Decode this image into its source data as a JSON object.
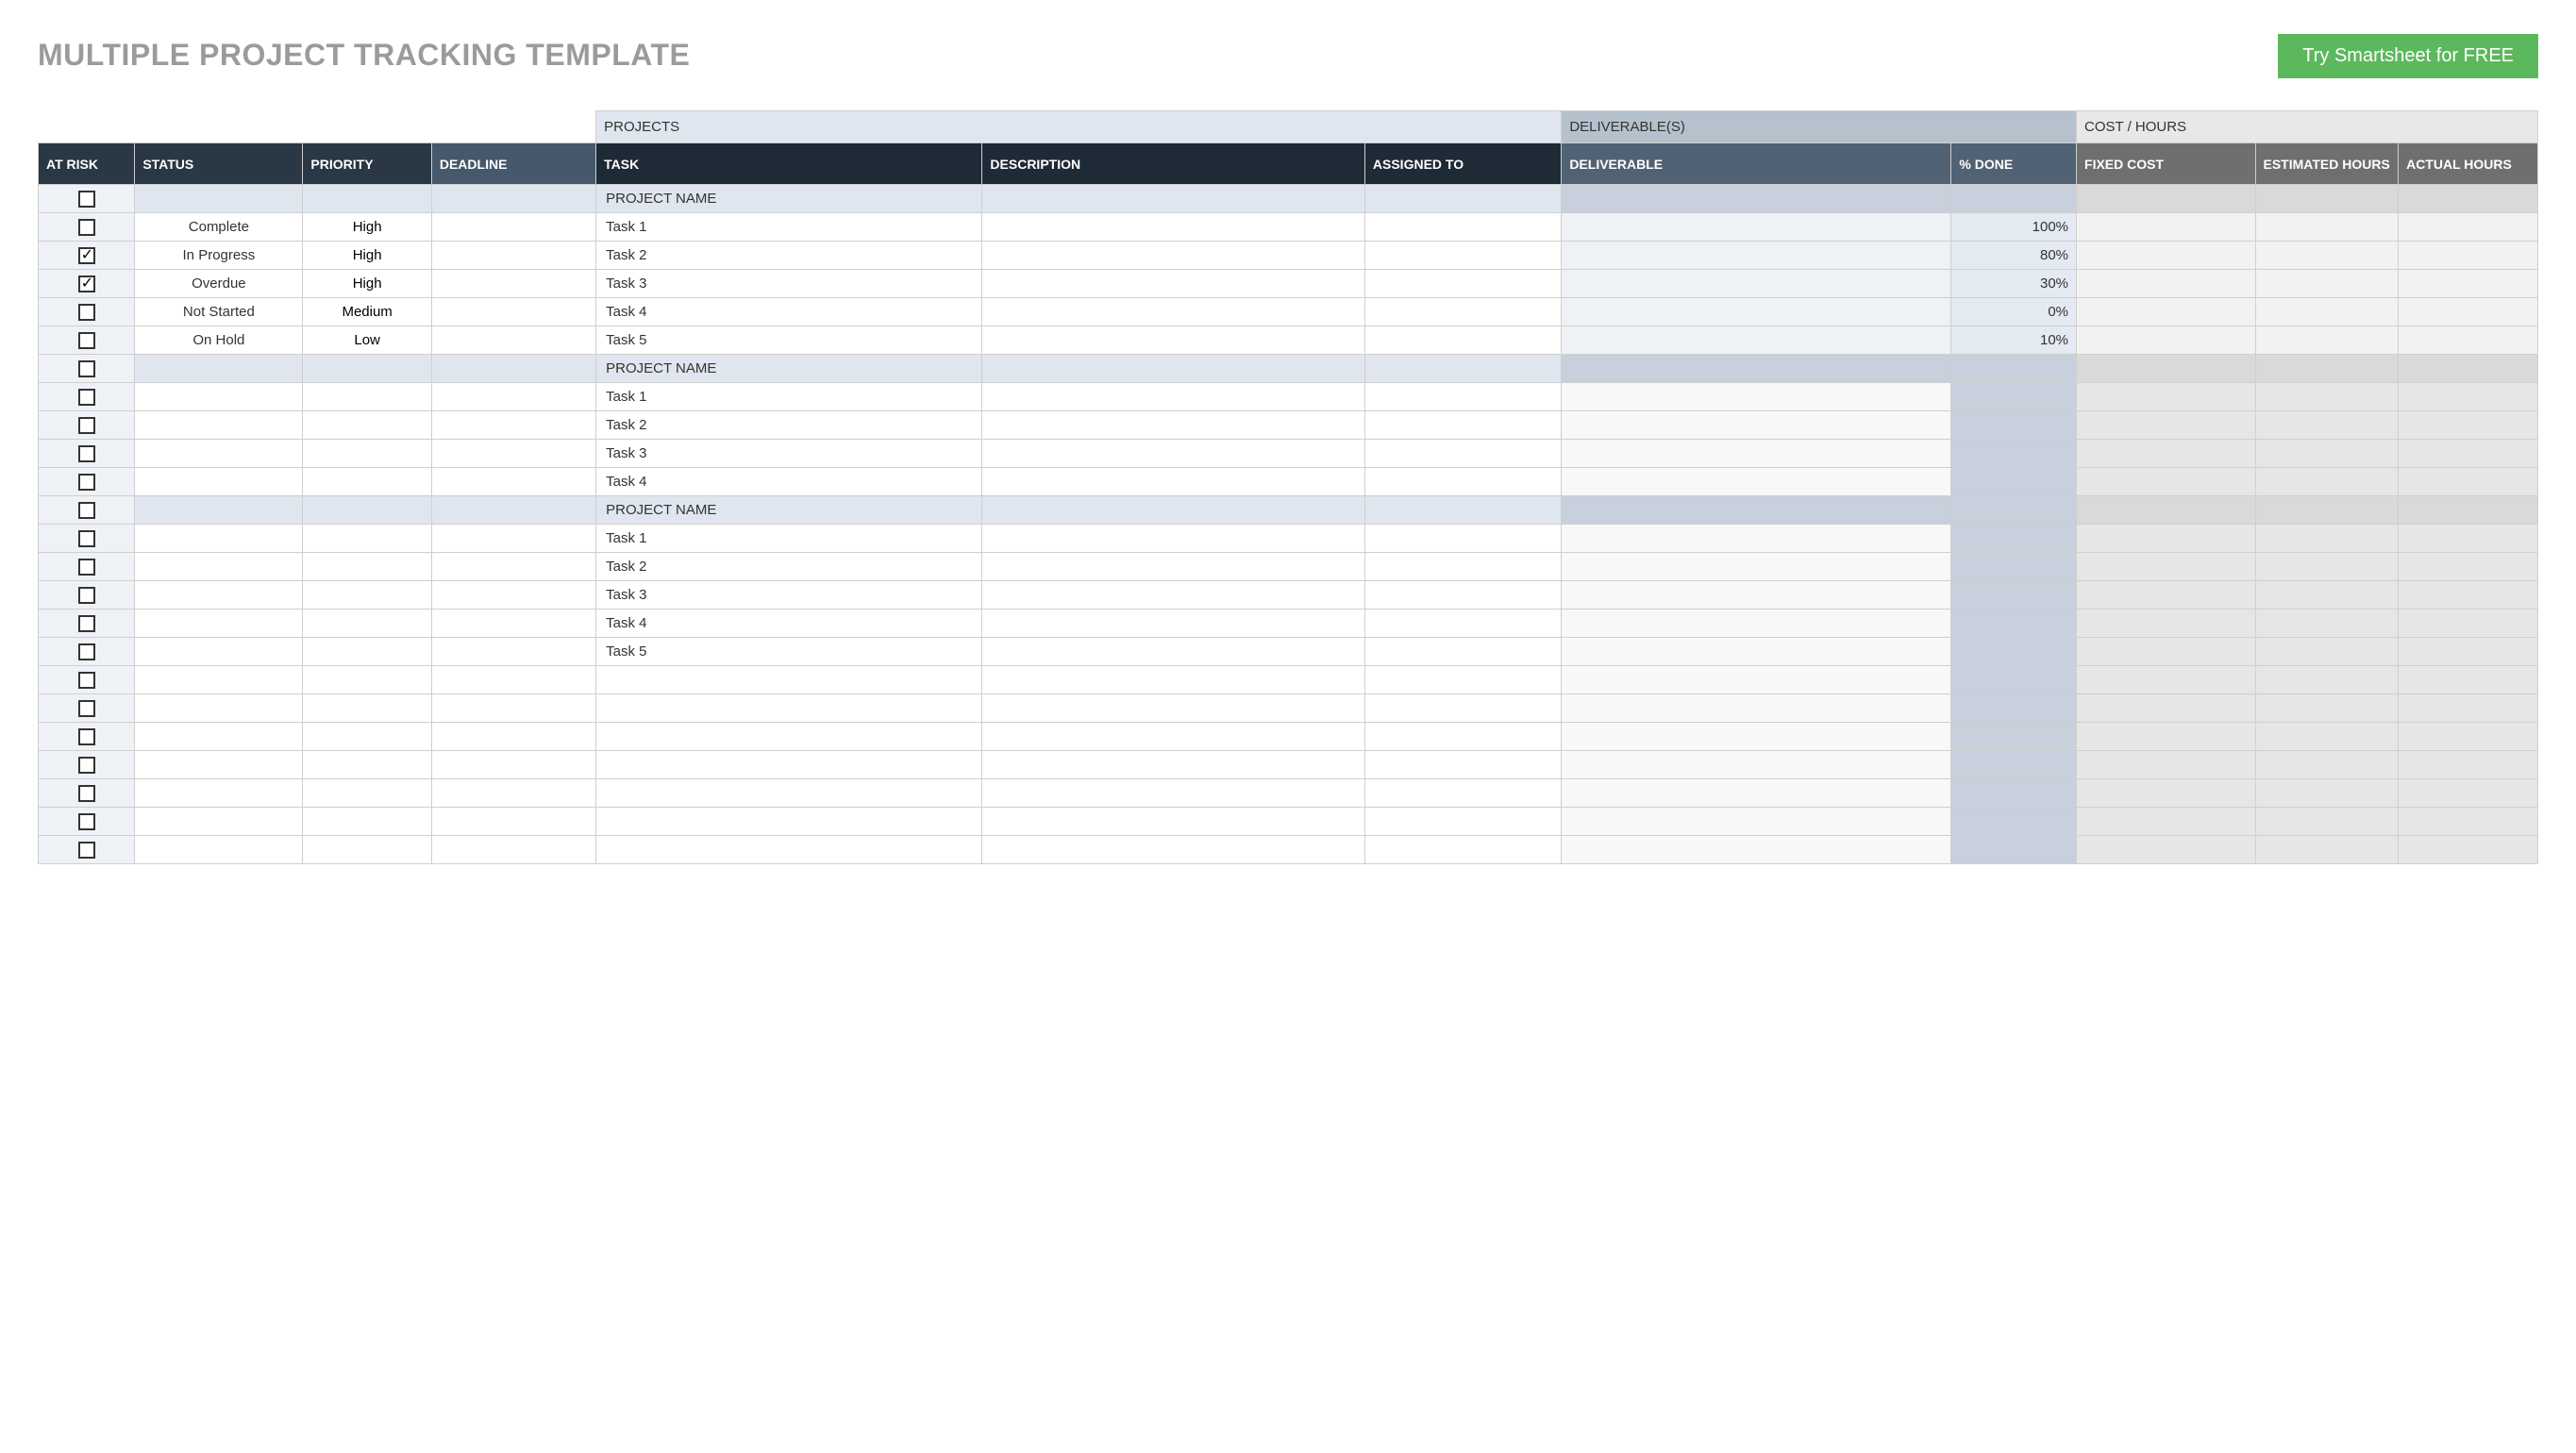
{
  "title": "MULTIPLE PROJECT TRACKING TEMPLATE",
  "cta": "Try Smartsheet for FREE",
  "categories": {
    "projects": "PROJECTS",
    "deliverables": "DELIVERABLE(S)",
    "cost": "COST / HOURS"
  },
  "headers": {
    "risk": "AT RISK",
    "status": "STATUS",
    "priority": "PRIORITY",
    "deadline": "DEADLINE",
    "task": "TASK",
    "description": "DESCRIPTION",
    "assigned": "ASSIGNED TO",
    "deliverable": "DELIVERABLE",
    "done": "% DONE",
    "fcost": "FIXED COST",
    "ehours": "ESTIMATED HOURS",
    "ahours": "ACTUAL HOURS"
  },
  "rows": [
    {
      "type": "project",
      "risk": false,
      "task": "PROJECT NAME"
    },
    {
      "type": "task",
      "risk": false,
      "status": "Complete",
      "priority": "High",
      "task": "Task 1",
      "done": "100%"
    },
    {
      "type": "task",
      "risk": true,
      "status": "In Progress",
      "priority": "High",
      "task": "Task 2",
      "done": "80%"
    },
    {
      "type": "task",
      "risk": true,
      "status": "Overdue",
      "priority": "High",
      "task": "Task 3",
      "done": "30%"
    },
    {
      "type": "task",
      "risk": false,
      "status": "Not Started",
      "priority": "Medium",
      "task": "Task 4",
      "done": "0%"
    },
    {
      "type": "task",
      "risk": false,
      "status": "On Hold",
      "priority": "Low",
      "task": "Task 5",
      "done": "10%"
    },
    {
      "type": "project",
      "risk": false,
      "task": "PROJECT NAME",
      "variant": 2
    },
    {
      "type": "task",
      "risk": false,
      "task": "Task 1",
      "variant": 2
    },
    {
      "type": "task",
      "risk": false,
      "task": "Task 2",
      "variant": 2
    },
    {
      "type": "task",
      "risk": false,
      "task": "Task 3",
      "variant": 2
    },
    {
      "type": "task",
      "risk": false,
      "task": "Task 4",
      "variant": 2
    },
    {
      "type": "project",
      "risk": false,
      "task": "PROJECT NAME",
      "variant": 2
    },
    {
      "type": "task",
      "risk": false,
      "task": "Task 1",
      "variant": 2
    },
    {
      "type": "task",
      "risk": false,
      "task": "Task 2",
      "variant": 2
    },
    {
      "type": "task",
      "risk": false,
      "task": "Task 3",
      "variant": 2
    },
    {
      "type": "task",
      "risk": false,
      "task": "Task 4",
      "variant": 2
    },
    {
      "type": "task",
      "risk": false,
      "task": "Task 5",
      "variant": 2
    },
    {
      "type": "task",
      "risk": false,
      "variant": 2
    },
    {
      "type": "task",
      "risk": false,
      "variant": 2
    },
    {
      "type": "task",
      "risk": false,
      "variant": 2
    },
    {
      "type": "task",
      "risk": false,
      "variant": 2
    },
    {
      "type": "task",
      "risk": false,
      "variant": 2
    },
    {
      "type": "task",
      "risk": false,
      "variant": 2
    },
    {
      "type": "task",
      "risk": false,
      "variant": 2
    }
  ],
  "statusClass": {
    "Complete": "st-Complete",
    "In Progress": "st-InProgress",
    "Overdue": "st-Overdue",
    "Not Started": "st-NotStarted",
    "On Hold": "st-OnHold"
  },
  "priorityClass": {
    "High": "pr-High",
    "Medium": "pr-Medium",
    "Low": "pr-Low"
  }
}
